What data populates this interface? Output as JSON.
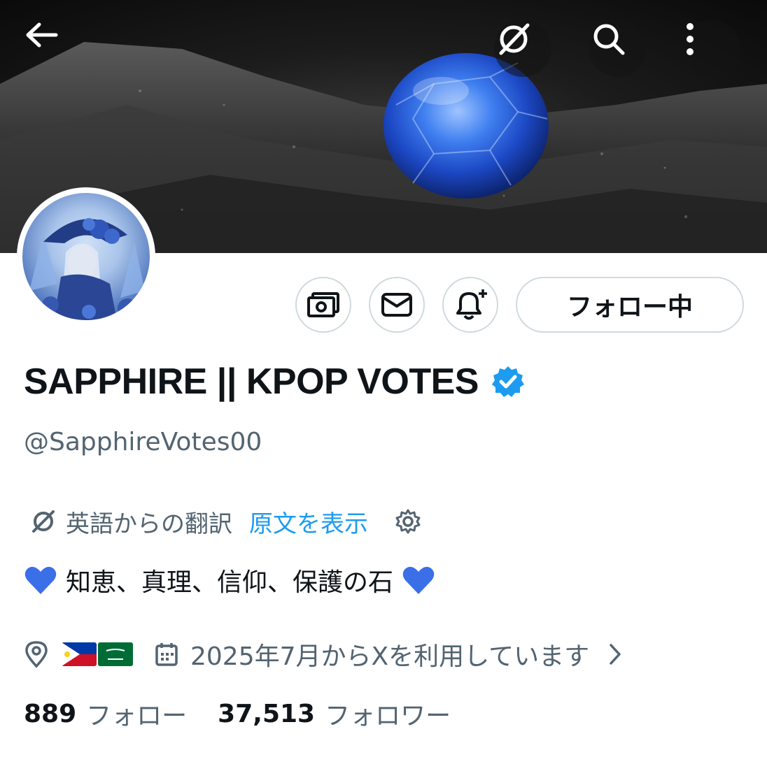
{
  "header": {
    "back_icon": "arrow-left-icon",
    "actions": [
      "translate-off-icon",
      "search-icon",
      "more-vertical-icon"
    ]
  },
  "profile": {
    "display_name": "SAPPHIRE || KPOP VOTES",
    "handle": "@SapphireVotes00",
    "verified": true,
    "verified_color": "#1d9bf0"
  },
  "buttons": {
    "subscribe_icon": "money-icon",
    "message_icon": "mail-icon",
    "notify_icon": "bell-plus-icon",
    "follow_label": "フォロー中"
  },
  "translation": {
    "label": "英語からの翻訳",
    "link": "原文を表示",
    "settings_icon": "gear-icon"
  },
  "bio": {
    "lead_emoji": "blue-heart",
    "text": "知恵、真理、信仰、保護の石",
    "trail_emoji": "blue-heart"
  },
  "meta": {
    "location_flags": [
      "philippines-flag",
      "saudi-arabia-flag"
    ],
    "joined": "2025年7月からXを利用しています"
  },
  "stats": {
    "following_count": "889",
    "following_label": "フォロー",
    "followers_count": "37,513",
    "followers_label": "フォロワー"
  },
  "colors": {
    "text_primary": "#0f1419",
    "text_secondary": "#536471",
    "accent": "#1d9bf0",
    "border": "#cfd9de",
    "heart": "#3b6fe8"
  }
}
